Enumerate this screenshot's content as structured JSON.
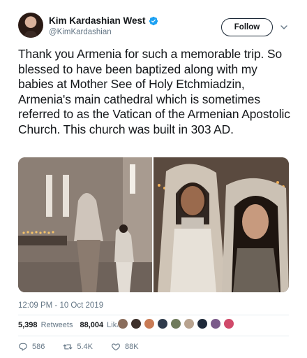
{
  "author": {
    "display_name": "Kim Kardashian West",
    "handle": "@KimKardashian",
    "verified": true
  },
  "follow_button": {
    "label": "Follow"
  },
  "tweet": {
    "text": "Thank you Armenia for such a memorable trip. So blessed to have been baptized along with my babies at Mother See of Holy Etchmiadzin, Armenia's main cathedral which is sometimes referred to as the Vatican of the Armenian Apostolic Church. This church was built in 303 AD.",
    "timestamp": "12:09 PM - 10 Oct 2019"
  },
  "stats": {
    "retweets_count": "5,398",
    "retweets_label": "Retweets",
    "likes_count": "88,004",
    "likes_label": "Likes"
  },
  "liker_avatar_colors": [
    "#8a6d5c",
    "#3c2f2a",
    "#c97b55",
    "#2f3b4c",
    "#6f7b5c",
    "#b8a38f",
    "#1f2a3a",
    "#7a5a8a",
    "#d04a6a"
  ],
  "actions": {
    "reply_count": "586",
    "retweet_count": "5.4K",
    "like_count": "88K"
  },
  "icons": {
    "verified": "verified-badge-icon",
    "more": "chevron-down-icon",
    "reply": "reply-icon",
    "retweet": "retweet-icon",
    "like": "heart-icon"
  },
  "colors": {
    "verified_blue": "#1da1f2",
    "secondary_text": "#657786",
    "primary_text": "#14171a"
  }
}
